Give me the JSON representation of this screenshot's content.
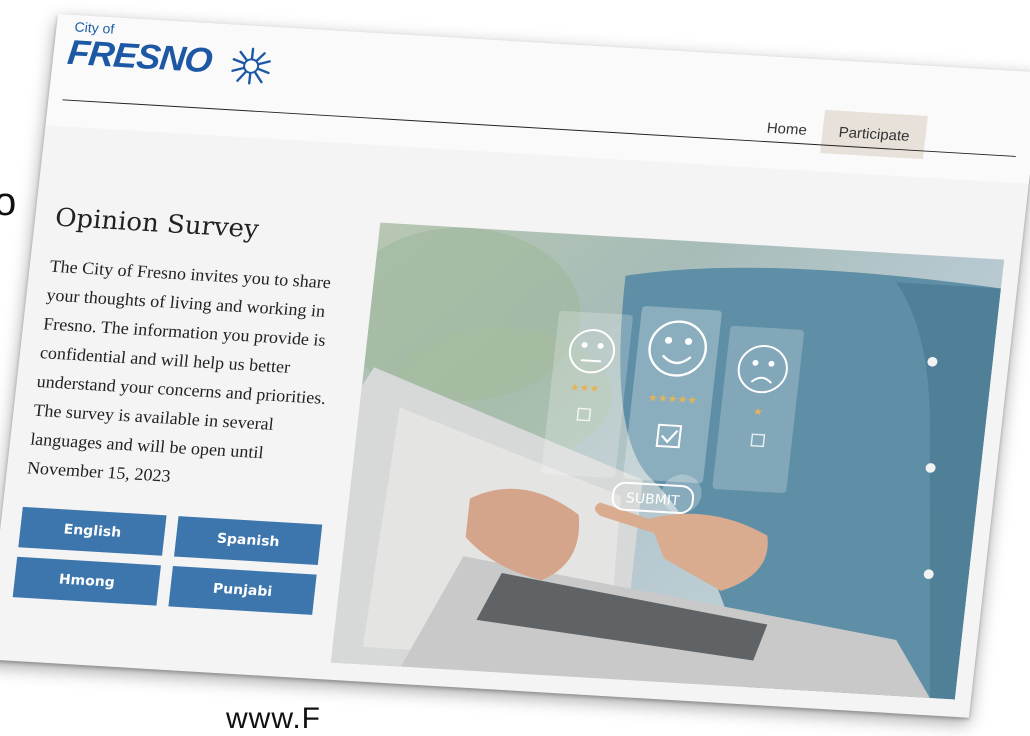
{
  "edge_fragment": "o",
  "bottom_fragment": "www.F",
  "header": {
    "logo_top": "City of",
    "logo_name": "FRESNO",
    "nav": [
      {
        "label": "Home"
      },
      {
        "label": "Participate"
      }
    ]
  },
  "main": {
    "title": "Opinion Survey",
    "description": "The City of Fresno invites you to share your thoughts of living and working in Fresno. The information you provide is confidential and will help us better understand your concerns and priorities. The survey is available in several languages and will be open until November 15, 2023",
    "languages": [
      "English",
      "Spanish",
      "Hmong",
      "Punjabi"
    ]
  },
  "hero": {
    "submit_label": "SUBMIT",
    "rating_faces": [
      "neutral-face",
      "happy-face",
      "sad-face"
    ]
  },
  "colors": {
    "brand": "#1c58a4",
    "button": "#3d76ad",
    "active_nav": "#e7e1da"
  }
}
